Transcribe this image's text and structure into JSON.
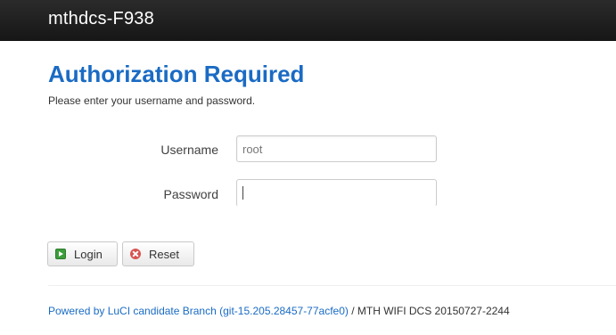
{
  "header": {
    "brand": "mthdcs-F938"
  },
  "auth": {
    "title": "Authorization Required",
    "description": "Please enter your username and password."
  },
  "form": {
    "username_label": "Username",
    "username_value": "root",
    "password_label": "Password",
    "password_value": ""
  },
  "actions": {
    "login_label": "Login",
    "login_icon": "login-icon",
    "reset_label": "Reset",
    "reset_icon": "reset-icon"
  },
  "footer": {
    "link_text": "Powered by LuCI candidate Branch (git-15.205.28457-77acfe0)",
    "separator": " / ",
    "firmware": "MTH WIFI DCS 20150727-2244"
  },
  "colors": {
    "header_bg": "#1f1f1f",
    "title": "#1a6bc4",
    "link": "#1a6bc4",
    "login_icon": "#3b9d3b",
    "reset_icon": "#d9534f"
  }
}
